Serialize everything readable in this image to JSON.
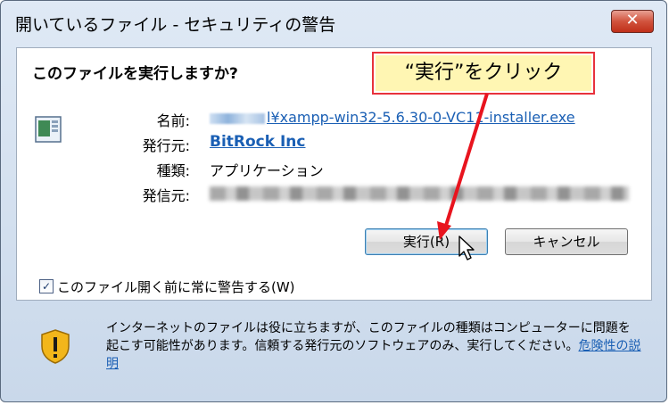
{
  "window": {
    "title": "開いているファイル - セキュリティの警告",
    "close_label": "✕"
  },
  "dialog": {
    "question": "このファイルを実行しますか?",
    "fields": {
      "name_label": "名前:",
      "name_value": "l¥xampp-win32-5.6.30-0-VC11-installer.exe",
      "publisher_label": "発行元:",
      "publisher_value": "BitRock Inc",
      "type_label": "種類:",
      "type_value": "アプリケーション",
      "source_label": "発信元:"
    },
    "buttons": {
      "run": "実行(R)",
      "cancel": "キャンセル"
    },
    "checkbox": {
      "label": "このファイル開く前に常に警告する(W)",
      "checked": true,
      "check_glyph": "✓"
    }
  },
  "annotation": {
    "callout_text": "“実行”をクリック",
    "border_color": "#e8323c",
    "fill_color": "#fff6b3"
  },
  "warning": {
    "text": "インターネットのファイルは役に立ちますが、このファイルの種類はコンピューターに問題を起こす可能性があります。信頼する発行元のソフトウェアのみ、実行してください。",
    "link": "危険性の説明"
  },
  "colors": {
    "link": "#1a5fb4",
    "title_gradient_top": "#dfe9f5",
    "close_button": "#c0301a"
  }
}
